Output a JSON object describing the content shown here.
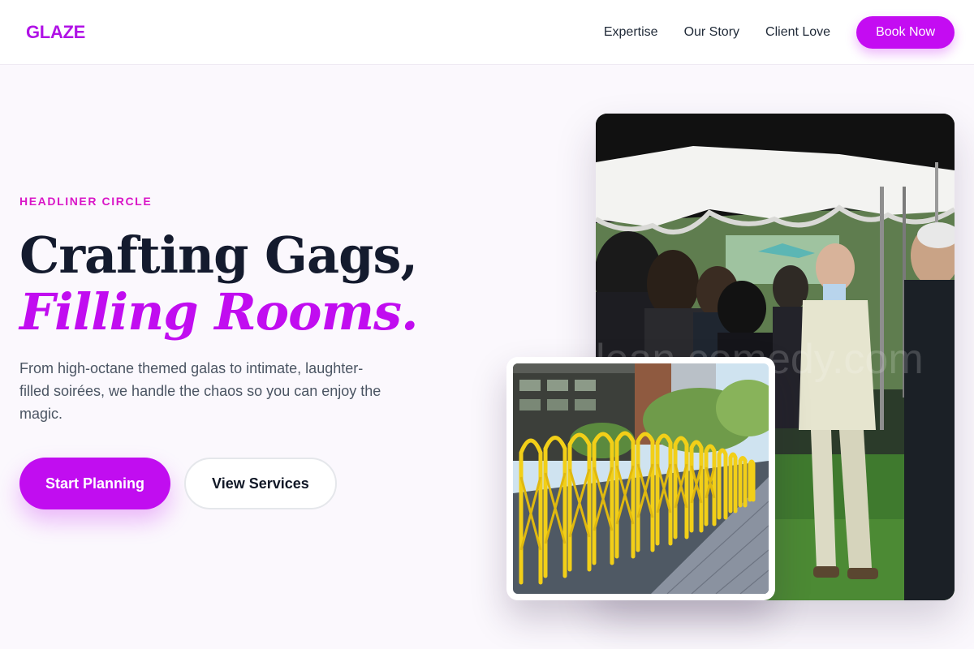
{
  "brand": {
    "logo": "GLAZE",
    "accent": "#c10df0",
    "eyebrow_color": "#d916c7"
  },
  "nav": {
    "links": [
      "Expertise",
      "Our Story",
      "Client Love"
    ],
    "cta": "Book Now"
  },
  "hero": {
    "eyebrow": "HEADLINER CIRCLE",
    "headline_line1": "Crafting Gags,",
    "headline_line2": "Filling Rooms.",
    "lede": "From high-octane themed galas to intimate, laughter-filled soirées, we handle the chaos so you can enjoy the magic.",
    "primary_cta": "Start Planning",
    "secondary_cta": "View Services"
  },
  "images": {
    "main": {
      "subject": "crowd-under-white-tent-photo"
    },
    "inset": {
      "subject": "yellow-folding-barricades-photo"
    }
  }
}
